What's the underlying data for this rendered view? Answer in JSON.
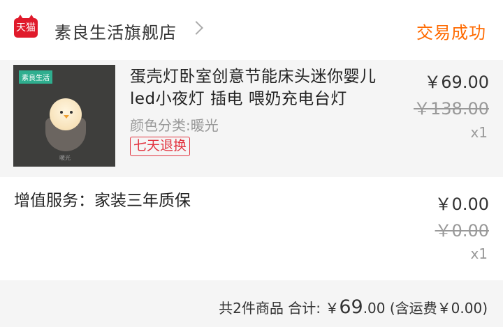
{
  "store": {
    "badge": "天猫",
    "name": "素良生活旗舰店",
    "status": "交易成功"
  },
  "item": {
    "thumb_tag": "素良生活",
    "thumb_caption": "暖光",
    "title": "蛋壳灯卧室创意节能床头迷你婴儿led小夜灯 插电 喂奶充电台灯",
    "variant": "颜色分类:暖光",
    "return_tag": "七天退换",
    "price": "￥69.00",
    "original_price": "￥138.00",
    "quantity": "x1"
  },
  "service": {
    "label": "增值服务：家装三年质保",
    "price": "￥0.00",
    "original_price": "￥0.00",
    "quantity": "x1"
  },
  "summary": {
    "count_text": "共2件商品",
    "total_label": "合计:",
    "currency": "￥",
    "total_int": "69",
    "total_dec": ".00",
    "shipping": "(含运费￥0.00)"
  },
  "colors": {
    "brand_red": "#e01a2b",
    "status_orange": "#ff6a00",
    "tag_red": "#e2333f"
  }
}
